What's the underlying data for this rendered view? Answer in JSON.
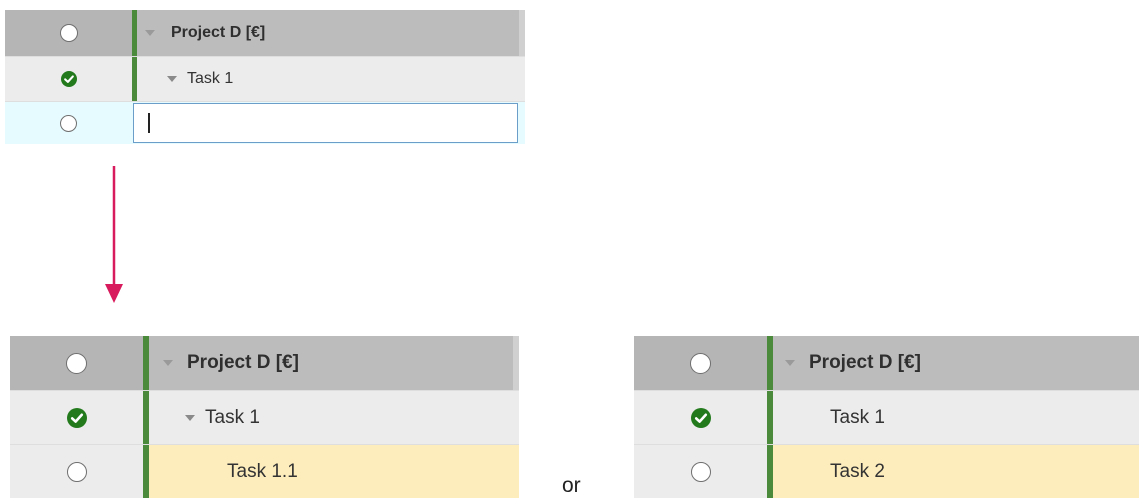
{
  "panel_before": {
    "project_label": "Project D [€]",
    "task_label": "Task 1",
    "edit_value": ""
  },
  "panel_option_a": {
    "project_label": "Project D [€]",
    "task_label": "Task 1",
    "new_task_label": "Task 1.1"
  },
  "panel_option_b": {
    "project_label": "Project D [€]",
    "task_label": "Task 1",
    "new_task_label": "Task 2"
  },
  "separator": "or",
  "colors": {
    "accent_green": "#4a8a3a",
    "check_green": "#237a1d",
    "arrow": "#d81b5c",
    "new_row_highlight": "#fdedbd",
    "edit_row_highlight": "#e6fbff"
  },
  "icons": {
    "status_empty": "radio-circle",
    "status_done": "check-circle",
    "expand": "caret-down",
    "flow": "arrow-down"
  }
}
